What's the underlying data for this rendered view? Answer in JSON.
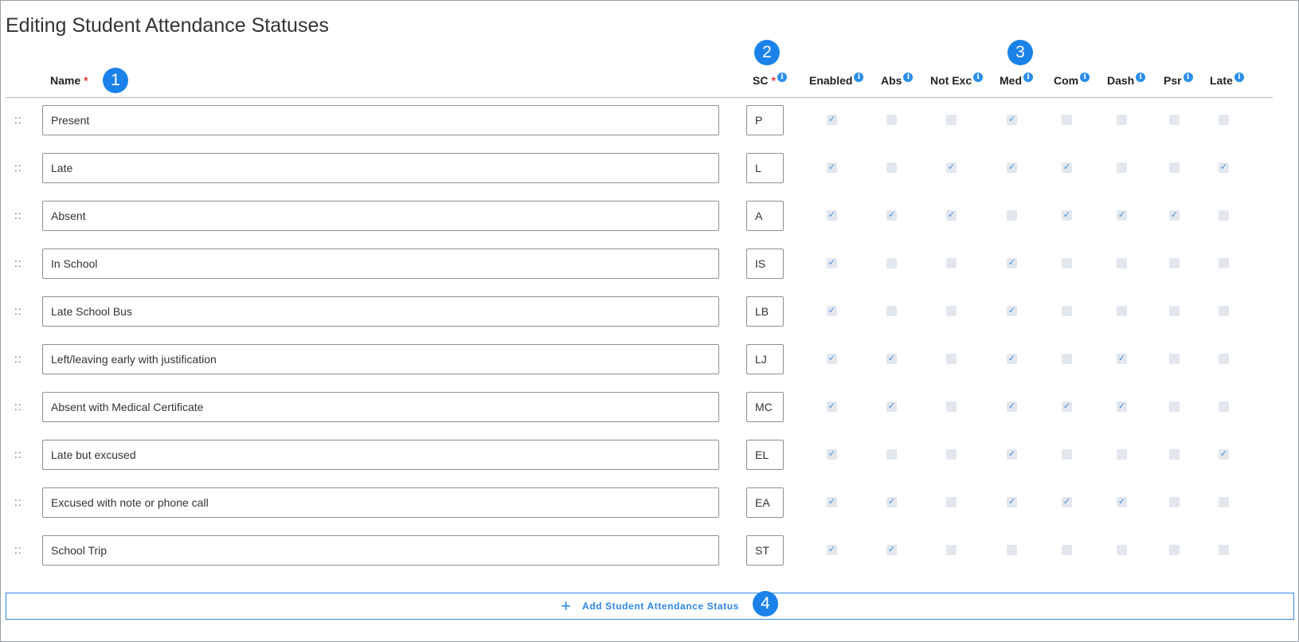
{
  "page": {
    "title": "Editing Student Attendance Statuses"
  },
  "columns": {
    "name": "Name",
    "required_mark": "*",
    "sc": "SC",
    "flags": [
      "Enabled",
      "Abs",
      "Not Exc",
      "Med",
      "Com",
      "Dash",
      "Psr",
      "Late"
    ]
  },
  "info_icon_glyph": "i",
  "drag_handle_glyph": "::",
  "check_glyph": "✓",
  "badges": [
    "1",
    "2",
    "3",
    "4"
  ],
  "rows": [
    {
      "name": "Present",
      "sc": "P",
      "flags": [
        true,
        false,
        false,
        true,
        false,
        false,
        false,
        false
      ]
    },
    {
      "name": "Late",
      "sc": "L",
      "flags": [
        true,
        false,
        true,
        true,
        true,
        false,
        false,
        true
      ]
    },
    {
      "name": "Absent",
      "sc": "A",
      "flags": [
        true,
        true,
        true,
        false,
        true,
        true,
        true,
        false
      ]
    },
    {
      "name": "In School",
      "sc": "IS",
      "flags": [
        true,
        false,
        false,
        true,
        false,
        false,
        false,
        false
      ]
    },
    {
      "name": "Late School Bus",
      "sc": "LB",
      "flags": [
        true,
        false,
        false,
        true,
        false,
        false,
        false,
        false
      ]
    },
    {
      "name": "Left/leaving early with justification",
      "sc": "LJ",
      "flags": [
        true,
        true,
        false,
        true,
        false,
        true,
        false,
        false
      ]
    },
    {
      "name": "Absent with Medical Certificate",
      "sc": "MC",
      "flags": [
        true,
        true,
        false,
        true,
        true,
        true,
        false,
        false
      ]
    },
    {
      "name": "Late but excused",
      "sc": "EL",
      "flags": [
        true,
        false,
        false,
        true,
        false,
        false,
        false,
        true
      ]
    },
    {
      "name": "Excused with note or phone call",
      "sc": "EA",
      "flags": [
        true,
        true,
        false,
        true,
        true,
        true,
        false,
        false
      ]
    },
    {
      "name": "School Trip",
      "sc": "ST",
      "flags": [
        true,
        true,
        false,
        false,
        false,
        false,
        false,
        false
      ]
    }
  ],
  "add_button": {
    "icon": "plus-icon",
    "label": "Add Student Attendance Status"
  },
  "colors": {
    "accent": "#1a82e8",
    "required": "#e53935",
    "checkbox_bg": "#e2e7ee",
    "check": "#3a8de0"
  }
}
